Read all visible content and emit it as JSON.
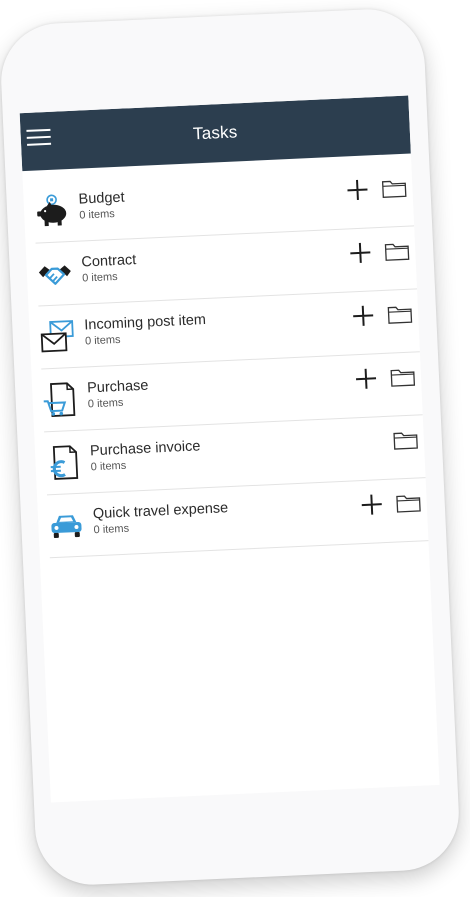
{
  "appbar": {
    "title": "Tasks",
    "menu_icon": "hamburger-menu-icon"
  },
  "tasks": [
    {
      "title": "Budget",
      "count": "0 items",
      "icon": "piggy-bank-icon",
      "can_add": true
    },
    {
      "title": "Contract",
      "count": "0 items",
      "icon": "handshake-icon",
      "can_add": true
    },
    {
      "title": "Incoming post item",
      "count": "0 items",
      "icon": "mail-envelope-icon",
      "can_add": true
    },
    {
      "title": "Purchase",
      "count": "0 items",
      "icon": "shopping-cart-document-icon",
      "can_add": true
    },
    {
      "title": "Purchase invoice",
      "count": "0 items",
      "icon": "euro-document-icon",
      "can_add": false
    },
    {
      "title": "Quick travel expense",
      "count": "0 items",
      "icon": "car-icon",
      "can_add": true
    }
  ],
  "colors": {
    "appbar": "#2c3e4f",
    "accent_blue": "#3a9bd8",
    "icon_dark": "#1c1c1c"
  }
}
